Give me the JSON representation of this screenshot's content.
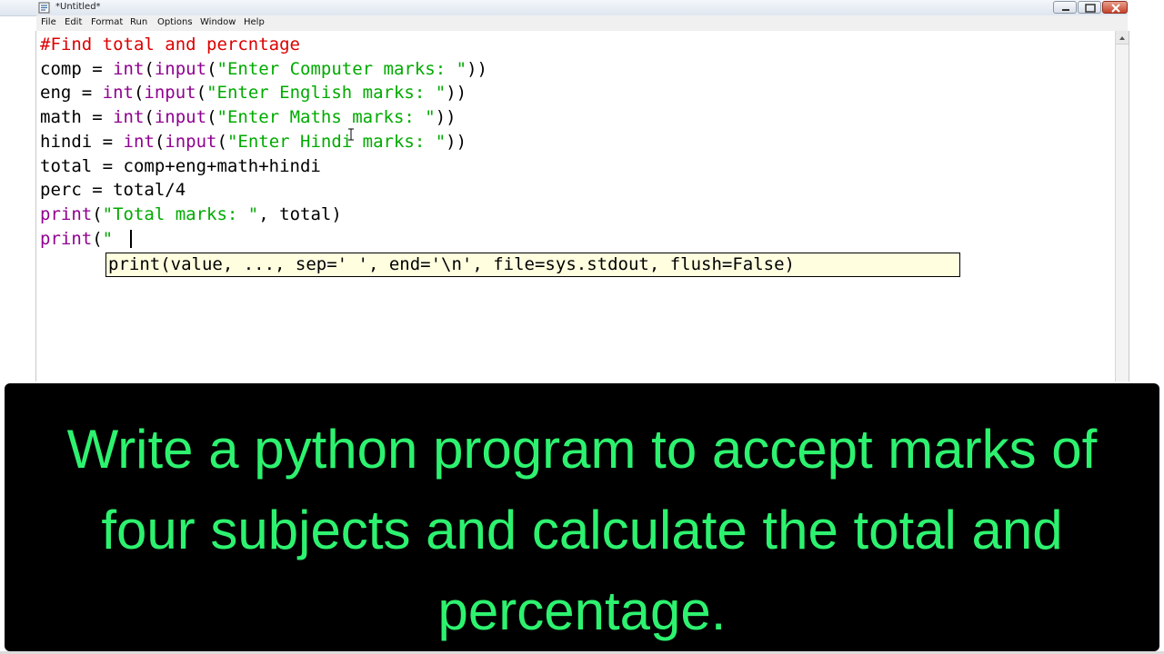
{
  "window": {
    "title": "*Untitled*"
  },
  "menubar": {
    "items": [
      "File",
      "Edit",
      "Format",
      "Run",
      "Options",
      "Window",
      "Help"
    ]
  },
  "editor": {
    "lines": [
      [
        {
          "t": "#Find total and percntage",
          "c": "comment"
        }
      ],
      [
        {
          "t": "comp = ",
          "c": "plain"
        },
        {
          "t": "int",
          "c": "builtin"
        },
        {
          "t": "(",
          "c": "plain"
        },
        {
          "t": "input",
          "c": "builtin"
        },
        {
          "t": "(",
          "c": "plain"
        },
        {
          "t": "\"Enter Computer marks: \"",
          "c": "string"
        },
        {
          "t": "))",
          "c": "plain"
        }
      ],
      [
        {
          "t": "eng = ",
          "c": "plain"
        },
        {
          "t": "int",
          "c": "builtin"
        },
        {
          "t": "(",
          "c": "plain"
        },
        {
          "t": "input",
          "c": "builtin"
        },
        {
          "t": "(",
          "c": "plain"
        },
        {
          "t": "\"Enter English marks: \"",
          "c": "string"
        },
        {
          "t": "))",
          "c": "plain"
        }
      ],
      [
        {
          "t": "math = ",
          "c": "plain"
        },
        {
          "t": "int",
          "c": "builtin"
        },
        {
          "t": "(",
          "c": "plain"
        },
        {
          "t": "input",
          "c": "builtin"
        },
        {
          "t": "(",
          "c": "plain"
        },
        {
          "t": "\"Enter Maths marks: \"",
          "c": "string"
        },
        {
          "t": "))",
          "c": "plain"
        }
      ],
      [
        {
          "t": "hindi = ",
          "c": "plain"
        },
        {
          "t": "int",
          "c": "builtin"
        },
        {
          "t": "(",
          "c": "plain"
        },
        {
          "t": "input",
          "c": "builtin"
        },
        {
          "t": "(",
          "c": "plain"
        },
        {
          "t": "\"Enter Hindi marks: \"",
          "c": "string"
        },
        {
          "t": "))",
          "c": "plain"
        }
      ],
      [
        {
          "t": "total = comp+eng+math+hindi",
          "c": "plain"
        }
      ],
      [
        {
          "t": "perc = total/4",
          "c": "plain"
        }
      ],
      [
        {
          "t": "print",
          "c": "builtin"
        },
        {
          "t": "(",
          "c": "plain"
        },
        {
          "t": "\"Total marks: \"",
          "c": "string"
        },
        {
          "t": ", total)",
          "c": "plain"
        }
      ],
      [
        {
          "t": "print",
          "c": "builtin"
        },
        {
          "t": "(",
          "c": "plain"
        },
        {
          "t": "\"",
          "c": "string"
        }
      ]
    ],
    "calltip": "print(value, ..., sep=' ', end='\\n', file=sys.stdout, flush=False)"
  },
  "caption": {
    "text": "Write a python program to accept marks of four subjects and calculate the total and percentage."
  },
  "colors": {
    "comment": "#dd0000",
    "builtin": "#900090",
    "string": "#00aa00",
    "caption_text": "#2df26f",
    "caption_bg": "#000000",
    "calltip_bg": "#ffffe0"
  },
  "icons": {
    "app": "idle-app-icon",
    "minimize": "minimize-icon",
    "maximize": "maximize-icon",
    "close": "close-icon"
  }
}
